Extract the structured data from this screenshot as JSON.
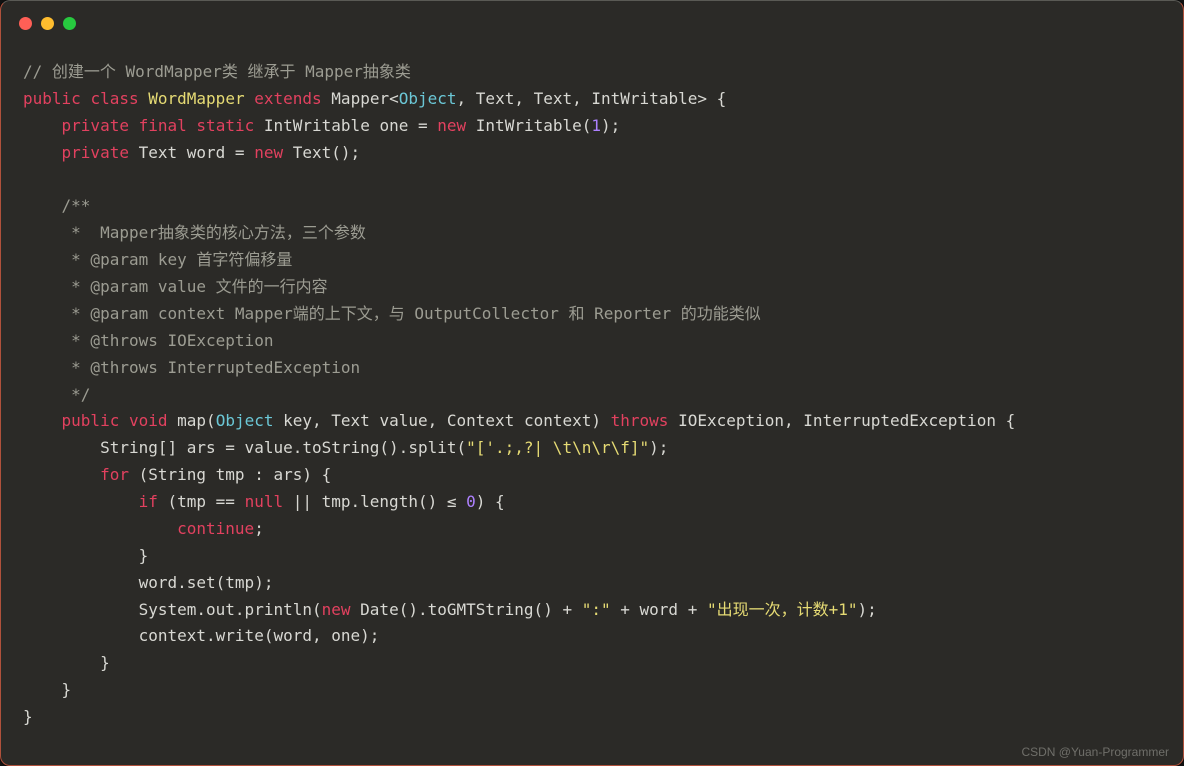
{
  "code": {
    "l1_comment": "// 创建一个 WordMapper类 继承于 Mapper抽象类",
    "l2": {
      "kw1": "public",
      "kw2": "class",
      "name": "WordMapper",
      "kw3": "extends",
      "mapper": "Mapper",
      "gObj": "Object",
      "rest": ", Text, Text, IntWritable> {"
    },
    "l3": {
      "kw1": "private",
      "kw2": "final",
      "kw3": "static",
      "t1": "IntWritable one = ",
      "kw4": "new",
      "t2": " IntWritable(",
      "num": "1",
      "t3": ");"
    },
    "l4": {
      "kw1": "private",
      "t1": " Text word = ",
      "kw2": "new",
      "t2": " Text();"
    },
    "l5": "",
    "l6": "    /**",
    "l7": "     *  Mapper抽象类的核心方法，三个参数",
    "l8": "     * @param key 首字符偏移量",
    "l9": "     * @param value 文件的一行内容",
    "l10": "     * @param context Mapper端的上下文，与 OutputCollector 和 Reporter 的功能类似",
    "l11": "     * @throws IOException",
    "l12": "     * @throws InterruptedException",
    "l13": "     */",
    "l14": {
      "kw1": "public",
      "kw2": "void",
      "fn": "map",
      "gObj": "Object",
      "mid": " key, Text value, Context context) ",
      "kw3": "throws",
      "rest": " IOException, InterruptedException {"
    },
    "l15": {
      "pre": "        String[] ars = value.toString().split(",
      "str": "\"['.;,?| \\t\\n\\r\\f]\"",
      "post": ");"
    },
    "l16": {
      "kw1": "for",
      "t1": " (String tmp : ars) {"
    },
    "l17": {
      "kw1": "if",
      "t1": " (tmp == ",
      "kw2": "null",
      "t2": " || tmp.length() ≤ ",
      "num": "0",
      "t3": ") {"
    },
    "l18": {
      "kw1": "continue",
      "t1": ";"
    },
    "l19": "            }",
    "l20": "            word.set(tmp);",
    "l21": {
      "pre": "            System.out.println(",
      "kw1": "new",
      "t1": " Date().toGMTString() + ",
      "str1": "\":\"",
      "t2": " + word + ",
      "str2": "\"出现一次，计数+1\"",
      "t3": ");"
    },
    "l22": "            context.write(word, one);",
    "l23": "        }",
    "l24": "    }",
    "l25": "}"
  },
  "watermark": "CSDN @Yuan-Programmer"
}
